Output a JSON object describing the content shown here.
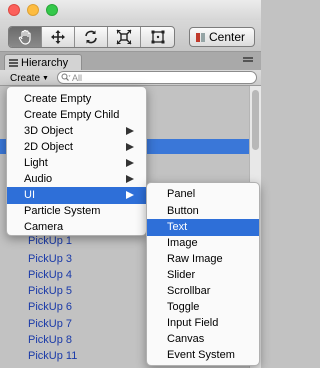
{
  "toolbar": {
    "tools": [
      "hand-tool",
      "move-tool",
      "rotate-tool",
      "scale-tool",
      "rect-tool"
    ],
    "pivot_label": "Center"
  },
  "hierarchy": {
    "tab_label": "Hierarchy",
    "create_label": "Create",
    "search_placeholder": "All",
    "rows": [
      "PickUp 1",
      "PickUp 3",
      "PickUp 4",
      "PickUp 5",
      "PickUp 6",
      "PickUp 7",
      "PickUp 8",
      "PickUp 11"
    ]
  },
  "create_menu": {
    "items": [
      {
        "label": "Create Empty",
        "submenu": false
      },
      {
        "label": "Create Empty Child",
        "submenu": false
      },
      {
        "label": "3D Object",
        "submenu": true
      },
      {
        "label": "2D Object",
        "submenu": true
      },
      {
        "label": "Light",
        "submenu": true
      },
      {
        "label": "Audio",
        "submenu": true
      },
      {
        "label": "UI",
        "submenu": true,
        "highlighted": true
      },
      {
        "label": "Particle System",
        "submenu": false
      },
      {
        "label": "Camera",
        "submenu": false
      }
    ]
  },
  "ui_submenu": {
    "items": [
      {
        "label": "Panel"
      },
      {
        "label": "Button"
      },
      {
        "label": "Text",
        "highlighted": true
      },
      {
        "label": "Image"
      },
      {
        "label": "Raw Image"
      },
      {
        "label": "Slider"
      },
      {
        "label": "Scrollbar"
      },
      {
        "label": "Toggle"
      },
      {
        "label": "Input Field"
      },
      {
        "label": "Canvas"
      },
      {
        "label": "Event System"
      }
    ]
  },
  "colors": {
    "highlight": "#2e6fd8",
    "selection": "#3a77d8",
    "object_text": "#1a3aa8"
  }
}
